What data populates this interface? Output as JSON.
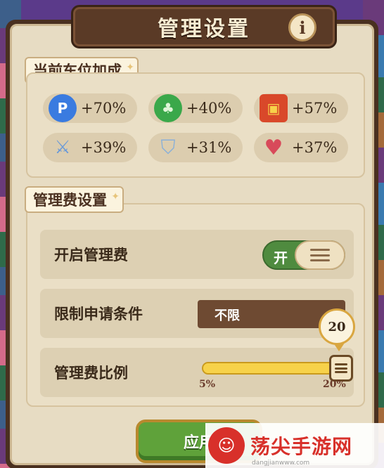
{
  "title": "管理设置",
  "info_button": "i",
  "bonus_section": {
    "label": "当前车位加成",
    "items": [
      {
        "icon": "coin-p-icon",
        "value": "+70%",
        "color": "#3a7be0"
      },
      {
        "icon": "clover-icon",
        "value": "+40%",
        "color": "#3aa84a"
      },
      {
        "icon": "book-icon",
        "value": "+57%",
        "color": "#d9482a"
      },
      {
        "icon": "sword-icon",
        "value": "+39%",
        "color": "#6a9ad8"
      },
      {
        "icon": "shield-icon",
        "value": "+31%",
        "color": "#8ab0d8"
      },
      {
        "icon": "heart-icon",
        "value": "+37%",
        "color": "#d84a5a"
      }
    ]
  },
  "fee_section": {
    "label": "管理费设置",
    "enable": {
      "label": "开启管理费",
      "state": "开"
    },
    "limit": {
      "label": "限制申请条件",
      "value": "不限"
    },
    "ratio": {
      "label": "管理费比例",
      "value": "20",
      "fraction": 1.0,
      "min_label": "5%",
      "max_label": "20%"
    }
  },
  "apply_button": "应用",
  "watermark": {
    "text": "荡尖手游网",
    "sub": "dangjianwww.com"
  },
  "colors": {
    "accent_green": "#5fa23a",
    "panel_brown": "#5a3a26",
    "slider_yellow": "#f0c23c"
  }
}
